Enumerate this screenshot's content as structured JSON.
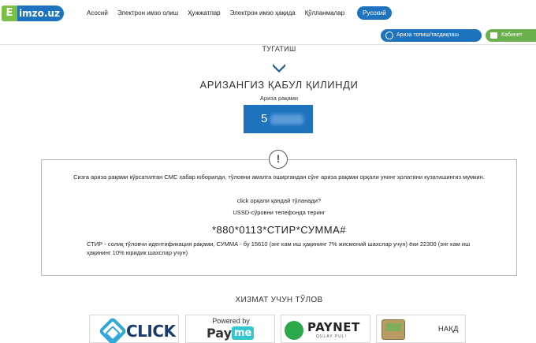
{
  "logo": {
    "mark": "E",
    "text": "imzo.uz"
  },
  "nav": {
    "items": [
      {
        "label": "Асосий"
      },
      {
        "label": "Электрон имзо олиш"
      },
      {
        "label": "Ҳужжатлар"
      },
      {
        "label": "Электрон имзо ҳақида"
      },
      {
        "label": "Қўлланмалар"
      }
    ],
    "language": "Русский"
  },
  "actions": {
    "find_application": "Ариза топиш/тасдиқлаш",
    "cabinet": "Кабинет"
  },
  "step": {
    "title": "ТУГАТИШ"
  },
  "result": {
    "heading": "АРИЗАНГИЗ ҚАБУЛ ҚИЛИНДИ",
    "number_label": "Ариза рақами",
    "number_visible": "5"
  },
  "info": {
    "icon": "exclamation-icon",
    "sms_notice": "Сизга ариза рақами кўрсатилган СМС хабар юборилди, тўловни амалга оширгандан сўнг ариза рақами орқали унинг ҳолатини кузатишингиз мумкин.",
    "click_question": "click орқали қандай тўланади?",
    "ussd_instruction": "USSD-сўровни телефонда теринг",
    "ussd_code": "*880*0113*СТИР*СУММА#",
    "legend": "СТИР - солиқ тўловчи идентификация рақами, СУММА - бу 15610 (энг кам иш ҳақининг 7% жисмоний шахслар учун) ёки 22300 (энг кам иш ҳақининг 10% юридик шахслар учун)"
  },
  "payment": {
    "title": "ХИЗМАТ УЧУН ТЎЛОВ",
    "click": {
      "logo_text": "CLICK"
    },
    "payme": {
      "powered_by": "Powered by",
      "logo_pay": "Pay",
      "logo_me": "me"
    },
    "paynet": {
      "logo_text": "PAYNET",
      "tagline": "QULAY PUL!"
    },
    "cash": {
      "label": "НАҚД"
    }
  },
  "colors": {
    "primary": "#1e73be",
    "accent_green": "#6ab04c",
    "click_blue": "#2fa7d8",
    "paynet_green": "#2aa84a"
  }
}
